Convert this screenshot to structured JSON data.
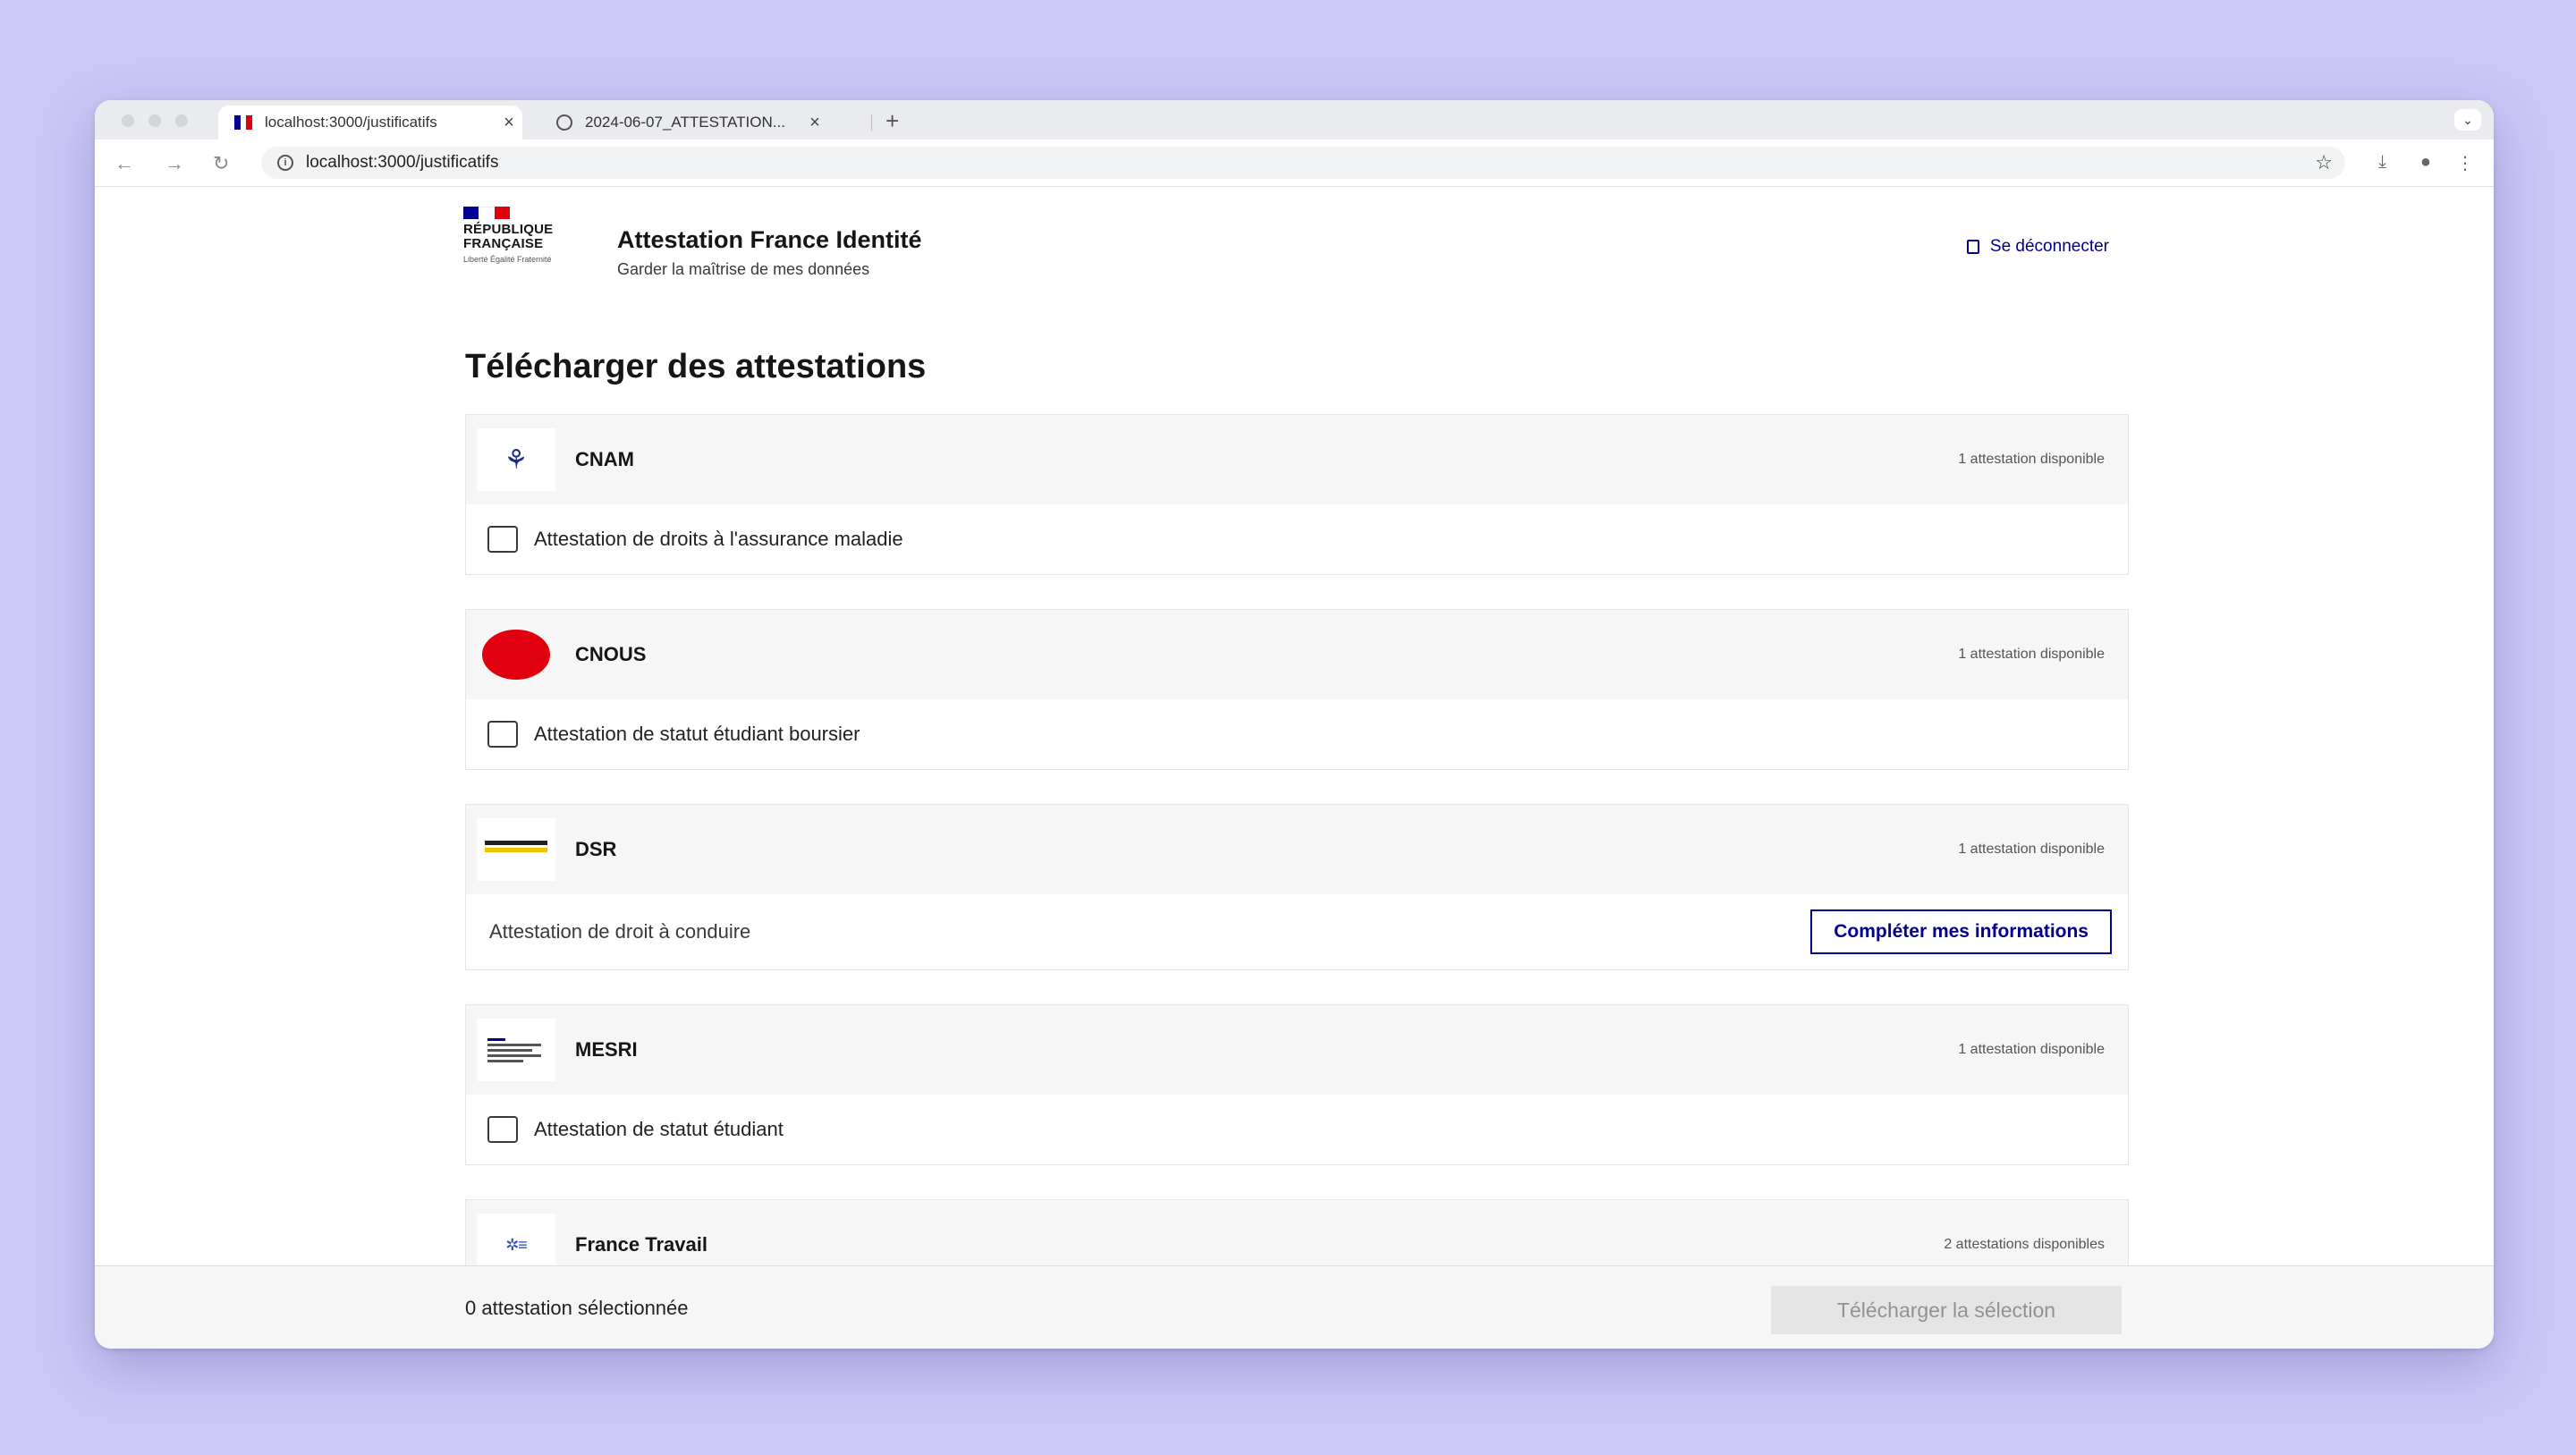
{
  "browser": {
    "tabs": [
      {
        "title": "localhost:3000/justificatifs",
        "active": true
      },
      {
        "title": "2024-06-07_ATTESTATION...",
        "active": false
      }
    ],
    "new_tab_label": "+",
    "url": "localhost:3000/justificatifs"
  },
  "header": {
    "republique_line1": "RÉPUBLIQUE",
    "republique_line2": "FRANÇAISE",
    "devise": "Liberté Égalité Fraternité",
    "service_title": "Attestation France Identité",
    "service_tagline": "Garder la maîtrise de mes données",
    "logout_label": "Se déconnecter"
  },
  "page": {
    "title": "Télécharger des attestations"
  },
  "providers": [
    {
      "name": "CNAM",
      "count": "1 attestation disponible",
      "attestation": "Attestation de droits à l'assurance maladie",
      "type": "checkbox"
    },
    {
      "name": "CNOUS",
      "count": "1 attestation disponible",
      "attestation": "Attestation de statut étudiant boursier",
      "type": "checkbox"
    },
    {
      "name": "DSR",
      "count": "1 attestation disponible",
      "attestation": "Attestation de droit à conduire",
      "type": "action",
      "action_label": "Compléter mes informations"
    },
    {
      "name": "MESRI",
      "count": "1 attestation disponible",
      "attestation": "Attestation de statut étudiant",
      "type": "checkbox"
    },
    {
      "name": "France Travail",
      "count": "2 attestations disponibles"
    }
  ],
  "footer": {
    "selection_count": "0 attestation sélectionnée",
    "download_label": "Télécharger la sélection"
  },
  "colors": {
    "background": "#cbc8f7",
    "primary_blue": "#000091",
    "marianne_red": "#e1000f",
    "disabled_bg": "#e5e5e5"
  }
}
